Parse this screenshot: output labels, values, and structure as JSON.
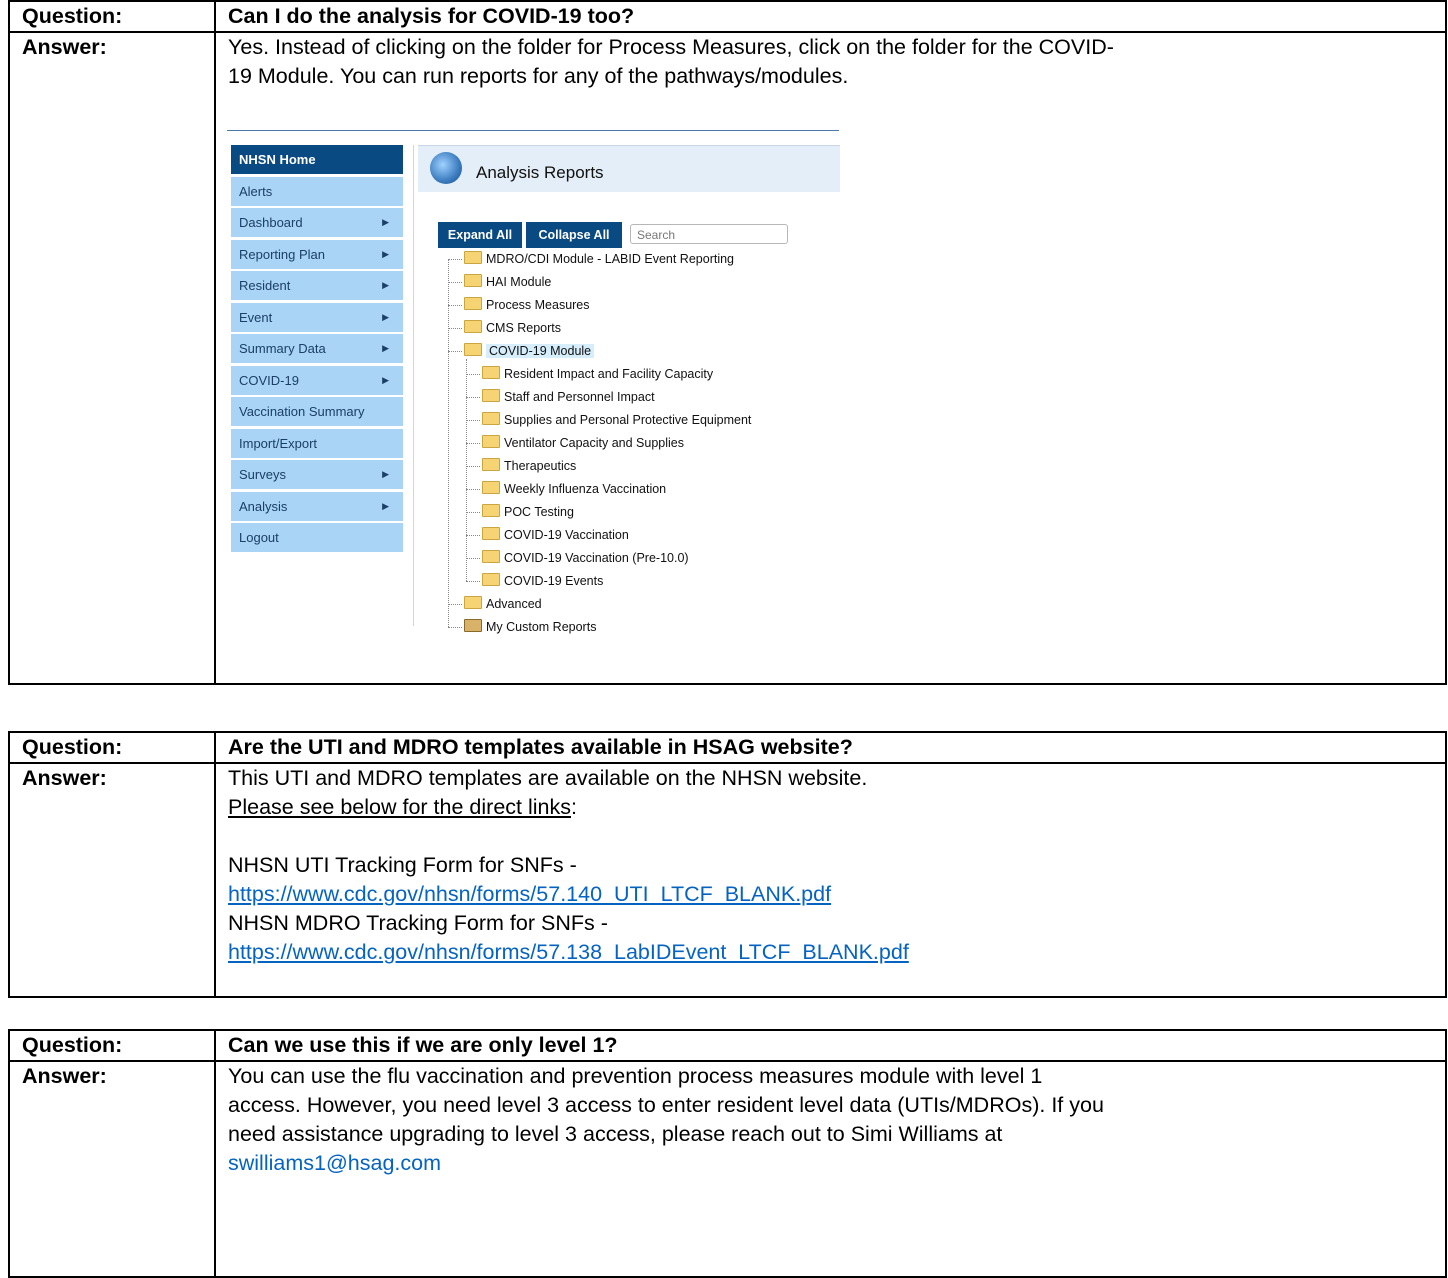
{
  "labels": {
    "question": "Question:",
    "answer": "Answer:"
  },
  "qa1": {
    "question": "Can I do the analysis for COVID-19 too?",
    "answer_line1": "Yes. Instead of clicking on the folder for Process Measures, click on the folder for the COVID-",
    "answer_line2": "19 Module. You can run reports for any of the pathways/modules."
  },
  "screenshot": {
    "menu": [
      {
        "label": "NHSN Home",
        "arrow": false
      },
      {
        "label": "Alerts",
        "arrow": false
      },
      {
        "label": "Dashboard",
        "arrow": true
      },
      {
        "label": "Reporting Plan",
        "arrow": true
      },
      {
        "label": "Resident",
        "arrow": true
      },
      {
        "label": "Event",
        "arrow": true
      },
      {
        "label": "Summary Data",
        "arrow": true
      },
      {
        "label": "COVID-19",
        "arrow": true
      },
      {
        "label": "Vaccination Summary",
        "arrow": false
      },
      {
        "label": "Import/Export",
        "arrow": false
      },
      {
        "label": "Surveys",
        "arrow": true
      },
      {
        "label": "Analysis",
        "arrow": true
      },
      {
        "label": "Logout",
        "arrow": false
      }
    ],
    "panel_title": "Analysis Reports",
    "expand_all": "Expand All",
    "collapse_all": "Collapse All",
    "search_placeholder": "Search",
    "tree": [
      {
        "label": "MDRO/CDI Module - LABID Event Reporting",
        "level": 0
      },
      {
        "label": "HAI Module",
        "level": 0
      },
      {
        "label": "Process Measures",
        "level": 0
      },
      {
        "label": "CMS Reports",
        "level": 0
      },
      {
        "label": "COVID-19 Module",
        "level": 0,
        "selected": true
      },
      {
        "label": "Resident Impact and Facility Capacity",
        "level": 1
      },
      {
        "label": "Staff and Personnel Impact",
        "level": 1
      },
      {
        "label": "Supplies and Personal Protective Equipment",
        "level": 1
      },
      {
        "label": "Ventilator Capacity and Supplies",
        "level": 1
      },
      {
        "label": "Therapeutics",
        "level": 1
      },
      {
        "label": "Weekly Influenza Vaccination",
        "level": 1
      },
      {
        "label": "POC Testing",
        "level": 1
      },
      {
        "label": "COVID-19 Vaccination",
        "level": 1
      },
      {
        "label": "COVID-19 Vaccination (Pre-10.0)",
        "level": 1
      },
      {
        "label": "COVID-19 Events",
        "level": 1
      },
      {
        "label": "Advanced",
        "level": 0
      },
      {
        "label": "My Custom Reports",
        "level": 0,
        "reports": true
      }
    ]
  },
  "qa2": {
    "question": "Are the UTI and MDRO templates available in HSAG website?",
    "answer_line1": "This UTI and MDRO templates are available on the NHSN website.",
    "answer_line2a": "Please see below for the direct links",
    "answer_line2b": ":",
    "uti_label": "NHSN UTI Tracking Form for SNFs -",
    "uti_link": "https://www.cdc.gov/nhsn/forms/57.140_UTI_LTCF_BLANK.pdf",
    "mdro_label": "NHSN MDRO Tracking Form for SNFs -",
    "mdro_link": "https://www.cdc.gov/nhsn/forms/57.138_LabIDEvent_LTCF_BLANK.pdf"
  },
  "qa3": {
    "question": "Can we use this if we are only level 1?",
    "answer_line1": "You can use the flu vaccination and prevention process measures module with level 1",
    "answer_line2": "access. However, you need level 3 access to enter resident level data (UTIs/MDROs). If you",
    "answer_line3": "need assistance upgrading to level 3 access, please reach out to Simi Williams at",
    "email": "swilliams1@hsag.com"
  }
}
